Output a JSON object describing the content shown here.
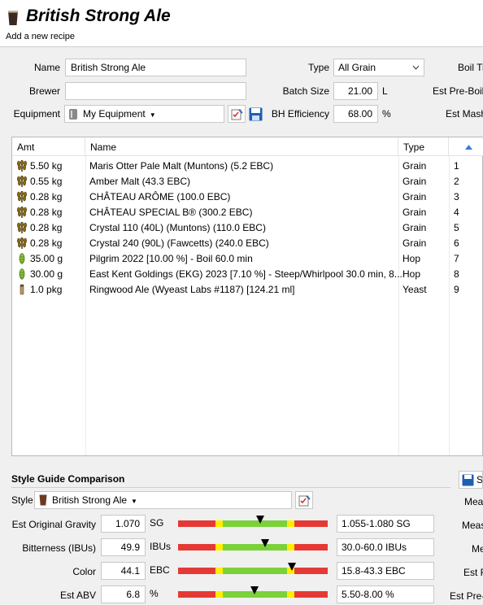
{
  "header": {
    "title": "British Strong Ale",
    "subtitle": "Add a new recipe"
  },
  "form": {
    "name_label": "Name",
    "name_value": "British Strong Ale",
    "brewer_label": "Brewer",
    "brewer_value": "",
    "equipment_label": "Equipment",
    "equipment_value": "My Equipment",
    "type_label": "Type",
    "type_value": "All Grain",
    "batch_size_label": "Batch Size",
    "batch_size_value": "21.00",
    "batch_size_unit": "L",
    "bh_eff_label": "BH Efficiency",
    "bh_eff_value": "68.00",
    "bh_eff_unit": "%",
    "boil_time_label": "Boil Ti",
    "est_preboil_label": "Est Pre-Boil",
    "est_mash_label": "Est Mash"
  },
  "table": {
    "columns": [
      "Amt",
      "Name",
      "Type"
    ],
    "rows": [
      {
        "amt": "5.50 kg",
        "name": "Maris Otter Pale Malt (Muntons) (5.2 EBC)",
        "type": "Grain",
        "num": "1",
        "icon": "grain-icon"
      },
      {
        "amt": "0.55 kg",
        "name": "Amber Malt (43.3 EBC)",
        "type": "Grain",
        "num": "2",
        "icon": "grain-icon"
      },
      {
        "amt": "0.28 kg",
        "name": "CHÂTEAU ARÔME (100.0 EBC)",
        "type": "Grain",
        "num": "3",
        "icon": "grain-icon"
      },
      {
        "amt": "0.28 kg",
        "name": "CHÂTEAU SPECIAL B® (300.2 EBC)",
        "type": "Grain",
        "num": "4",
        "icon": "grain-icon"
      },
      {
        "amt": "0.28 kg",
        "name": "Crystal 110 (40L) (Muntons) (110.0 EBC)",
        "type": "Grain",
        "num": "5",
        "icon": "grain-icon"
      },
      {
        "amt": "0.28 kg",
        "name": "Crystal 240 (90L) (Fawcetts) (240.0 EBC)",
        "type": "Grain",
        "num": "6",
        "icon": "grain-icon"
      },
      {
        "amt": "35.00 g",
        "name": "Pilgrim 2022 [10.00 %] - Boil 60.0 min",
        "type": "Hop",
        "num": "7",
        "icon": "hop-icon"
      },
      {
        "amt": "30.00 g",
        "name": "East Kent Goldings (EKG) 2023 [7.10 %] - Steep/Whirlpool  30.0 min, 8...",
        "type": "Hop",
        "num": "8",
        "icon": "hop-icon"
      },
      {
        "amt": "1.0 pkg",
        "name": "Ringwood Ale (Wyeast Labs #1187) [124.21 ml]",
        "type": "Yeast",
        "num": "9",
        "icon": "yeast-icon"
      }
    ]
  },
  "style_guide": {
    "title": "Style Guide Comparison",
    "style_label": "Style",
    "style_value": "British Strong Ale",
    "right_button_label": "Se",
    "right_labels": [
      "Mea",
      "Meas",
      "Me",
      "Est F",
      "Est Pre-"
    ],
    "rows": [
      {
        "label": "Est Original Gravity",
        "value": "1.070",
        "unit": "SG",
        "range": "1.055-1.080 SG",
        "position": 0.55
      },
      {
        "label": "Bitterness (IBUs)",
        "value": "49.9",
        "unit": "IBUs",
        "range": "30.0-60.0 IBUs",
        "position": 0.58
      },
      {
        "label": "Color",
        "value": "44.1",
        "unit": "EBC",
        "range": "15.8-43.3 EBC",
        "position": 0.76
      },
      {
        "label": "Est ABV",
        "value": "6.8",
        "unit": "%",
        "range": "5.50-8.00 %",
        "position": 0.51
      }
    ]
  },
  "colors": {
    "bar_red": "#e53935",
    "bar_yellow": "#ffee00",
    "bar_green": "#7bd13a"
  }
}
